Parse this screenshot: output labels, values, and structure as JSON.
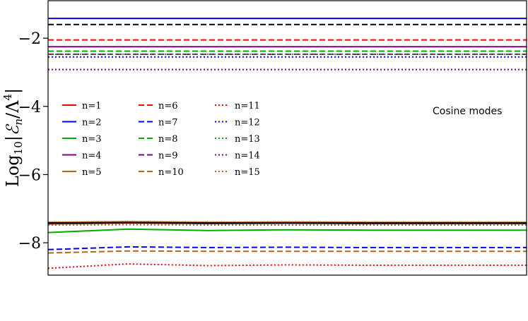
{
  "chart_data": {
    "type": "line",
    "title": "",
    "xlabel": "",
    "ylabel_parts": {
      "a": "Log",
      "b": "10",
      "c": "|",
      "d": "ℰ",
      "e": "n",
      "f": "/Λ",
      "g": "4",
      "h": "|"
    },
    "annotation": "Cosine modes",
    "ylim": [
      -8.95,
      -0.9
    ],
    "y_ticks": [
      {
        "value": -2,
        "label": "−2"
      },
      {
        "value": -4,
        "label": "−4"
      },
      {
        "value": -6,
        "label": "−6"
      },
      {
        "value": -8,
        "label": "−8"
      }
    ],
    "x_ticks_visible": false,
    "grid": false,
    "legend_placement": "upper-left",
    "series": [
      {
        "name": "n=1",
        "color": "#ff0000",
        "style": "solid",
        "values": [
          -7.45,
          -7.42,
          -7.44,
          -7.43,
          -7.44,
          -7.44,
          -7.44
        ]
      },
      {
        "name": "n=2",
        "color": "#0000ff",
        "style": "solid",
        "values": [
          -1.42,
          -1.42,
          -1.42,
          -1.42,
          -1.42,
          -1.42,
          -1.42
        ]
      },
      {
        "name": "n=3",
        "color": "#00aa00",
        "style": "solid",
        "values": [
          -7.7,
          -7.6,
          -7.64,
          -7.62,
          -7.63,
          -7.63,
          -7.63
        ]
      },
      {
        "name": "n=4",
        "color": "#800080",
        "style": "solid",
        "values": [
          -2.25,
          -2.25,
          -2.25,
          -2.25,
          -2.25,
          -2.25,
          -2.25
        ]
      },
      {
        "name": "n=5",
        "color": "#b8651b",
        "style": "solid",
        "values": [
          -7.4,
          -7.38,
          -7.4,
          -7.39,
          -7.4,
          -7.4,
          -7.4
        ]
      },
      {
        "name": "n=6",
        "color": "#ff0000",
        "style": "dashed",
        "values": [
          -2.05,
          -2.05,
          -2.05,
          -2.05,
          -2.05,
          -2.05,
          -2.05
        ]
      },
      {
        "name": "n=7",
        "color": "#0000ff",
        "style": "dashed",
        "values": [
          -8.2,
          -8.12,
          -8.14,
          -8.13,
          -8.14,
          -8.14,
          -8.14
        ]
      },
      {
        "name": "n=8",
        "color": "#00aa00",
        "style": "dashed",
        "values": [
          -2.38,
          -2.38,
          -2.38,
          -2.38,
          -2.38,
          -2.38,
          -2.38
        ]
      },
      {
        "name": "n=9",
        "color": "#800080",
        "style": "dashed",
        "values": [
          -2.47,
          -2.47,
          -2.47,
          -2.47,
          -2.47,
          -2.47,
          -2.47
        ]
      },
      {
        "name": "n=10",
        "color": "#b8651b",
        "style": "dashed",
        "values": [
          -8.3,
          -8.24,
          -8.25,
          -8.25,
          -8.25,
          -8.25,
          -8.25
        ]
      },
      {
        "name": "n=11",
        "color": "#ff0000",
        "style": "dotted",
        "values": [
          -8.75,
          -8.62,
          -8.67,
          -8.65,
          -8.66,
          -8.66,
          -8.66
        ]
      },
      {
        "name": "n=12",
        "color": "#0000ff",
        "style": "dotted",
        "values": [
          -2.55,
          -2.55,
          -2.55,
          -2.55,
          -2.55,
          -2.55,
          -2.55
        ]
      },
      {
        "name": "n=13",
        "color": "#00aa00",
        "style": "dotted",
        "values": [
          -2.47,
          -2.47,
          -2.47,
          -2.47,
          -2.47,
          -2.47,
          -2.47
        ]
      },
      {
        "name": "n=14",
        "color": "#800080",
        "style": "dotted",
        "values": [
          -2.92,
          -2.92,
          -2.92,
          -2.92,
          -2.92,
          -2.92,
          -2.92
        ]
      },
      {
        "name": "n=15",
        "color": "#b8651b",
        "style": "dotted",
        "values": [
          -7.48,
          -7.47,
          -7.48,
          -7.48,
          -7.48,
          -7.48,
          -7.48
        ]
      },
      {
        "color": "#000000",
        "style": "dashed",
        "values": [
          -1.6,
          -1.6,
          -1.6,
          -1.6,
          -1.6,
          -1.6,
          -1.6
        ]
      },
      {
        "color": "#000000",
        "style": "solid",
        "values": [
          -7.42,
          -7.41,
          -7.42,
          -7.42,
          -7.42,
          -7.42,
          -7.42
        ]
      }
    ]
  }
}
